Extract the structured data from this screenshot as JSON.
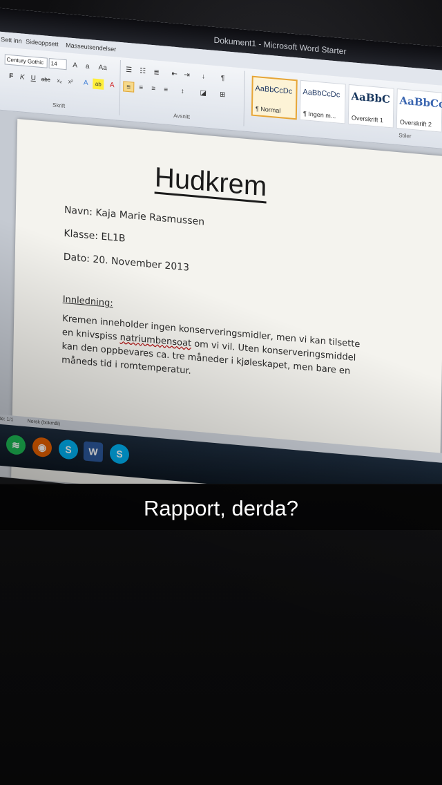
{
  "caption": "Rapport, derda?",
  "word_window": {
    "title": "Dokument1 - Microsoft Word Starter",
    "tabs": [
      "Sett inn",
      "Sideoppsett",
      "Masseutsendelser"
    ],
    "font_name": "Century Gothic",
    "font_size": "14",
    "groups": {
      "font": "Skrift",
      "paragraph": "Avsnitt",
      "styles": "Stiler"
    },
    "styles": [
      {
        "sample": "AaBbCcDc",
        "name": "¶ Normal"
      },
      {
        "sample": "AaBbCcDc",
        "name": "¶ Ingen m..."
      },
      {
        "sample": "AaBbC",
        "name": "Overskrift 1"
      },
      {
        "sample": "AaBbCc",
        "name": "Overskrift 2"
      }
    ],
    "status": {
      "page": "Side: 1/1",
      "language": "Norsk (bokmål)"
    }
  },
  "document": {
    "title": "Hudkrem",
    "name_line": "Navn: Kaja Marie Rasmussen",
    "class_line": "Klasse: EL1B",
    "date_line": "Dato: 20. November 2013",
    "heading": "Innledning:",
    "body": {
      "line1": "Kremen inneholder ingen konserveringsmidler, men vi kan tilsette",
      "line2_pre": "en knivspiss ",
      "line2_word": "natriumbensoat",
      "line2_post": " om vi vil. Uten konserveringsmiddel",
      "line3": "kan den oppbevares ca. tre måneder i kjøleskapet, men bare en",
      "line4": "måneds tid i romtemperatur."
    }
  },
  "taskbar": {
    "icons": [
      "spotify-icon",
      "firefox-icon",
      "skype-icon",
      "word-icon",
      "skype-icon"
    ]
  },
  "colors": {
    "caption_bg": "#000000",
    "selected_style": "#e6a537",
    "title_underline": "#1b1b1b"
  }
}
